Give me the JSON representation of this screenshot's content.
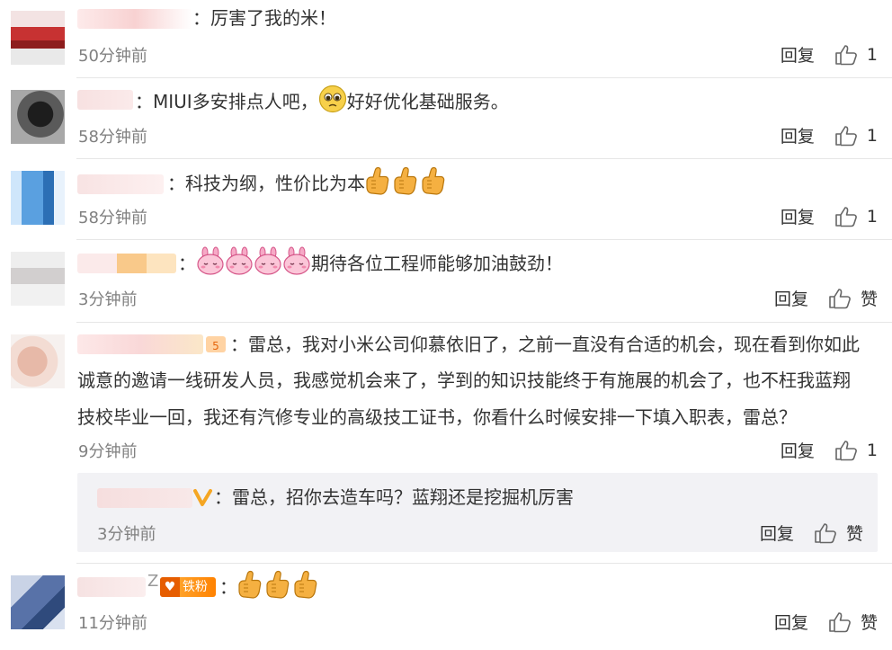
{
  "comments": [
    {
      "text": "：厉害了我的米！",
      "time": "50分钟前",
      "reply": "回复",
      "likes": "1"
    },
    {
      "text_a": "：MIUI多安排点人吧，",
      "text_b": "好好优化基础服务。",
      "time": "58分钟前",
      "reply": "回复",
      "likes": "1",
      "emoji": "pleading-face"
    },
    {
      "text": "：科技为纲，性价比为本",
      "time": "58分钟前",
      "reply": "回复",
      "likes": "1",
      "emoji": "thumbs-up"
    },
    {
      "text": "期待各位工程师能够加油鼓劲！",
      "time": "3分钟前",
      "reply": "回复",
      "likes": "赞",
      "emoji": "pink-bunny"
    },
    {
      "lines": [
        "：雷总，我对小米公司仰慕依旧了，之前一直没有合适的机会，现在看到你如此",
        "诚意的邀请一线研发人员，我感觉机会来了，学到的知识技能终于有施展的机会了，也不枉我蓝翔",
        "技校毕业一回，我还有汽修专业的高级技工证书，你看什么时候安排一下填入职表，雷总？"
      ],
      "time": "9分钟前",
      "reply": "回复",
      "likes": "1",
      "sub_reply": {
        "text": "：雷总，招你去造车吗？蓝翔还是挖掘机厉害",
        "time": "3分钟前",
        "reply": "回复",
        "likes": "赞",
        "badge": "V"
      }
    },
    {
      "name_suffix": "Z",
      "badge": "铁粉",
      "text": "：",
      "time": "11分钟前",
      "reply": "回复",
      "likes": "赞",
      "emoji": "thumbs-up"
    }
  ],
  "colors": {
    "text": "#333333",
    "time": "#808080",
    "divider": "#e6e6e6",
    "reply_bg": "#f2f2f5",
    "verified": "#f5a623",
    "fan_badge": "#ff8200"
  },
  "icons": [
    "thumbs-up-outline-icon",
    "pleading-face-emoji",
    "thumbs-up-emoji",
    "pink-bunny-emoji",
    "verified-v-icon",
    "iron-fan-badge"
  ]
}
